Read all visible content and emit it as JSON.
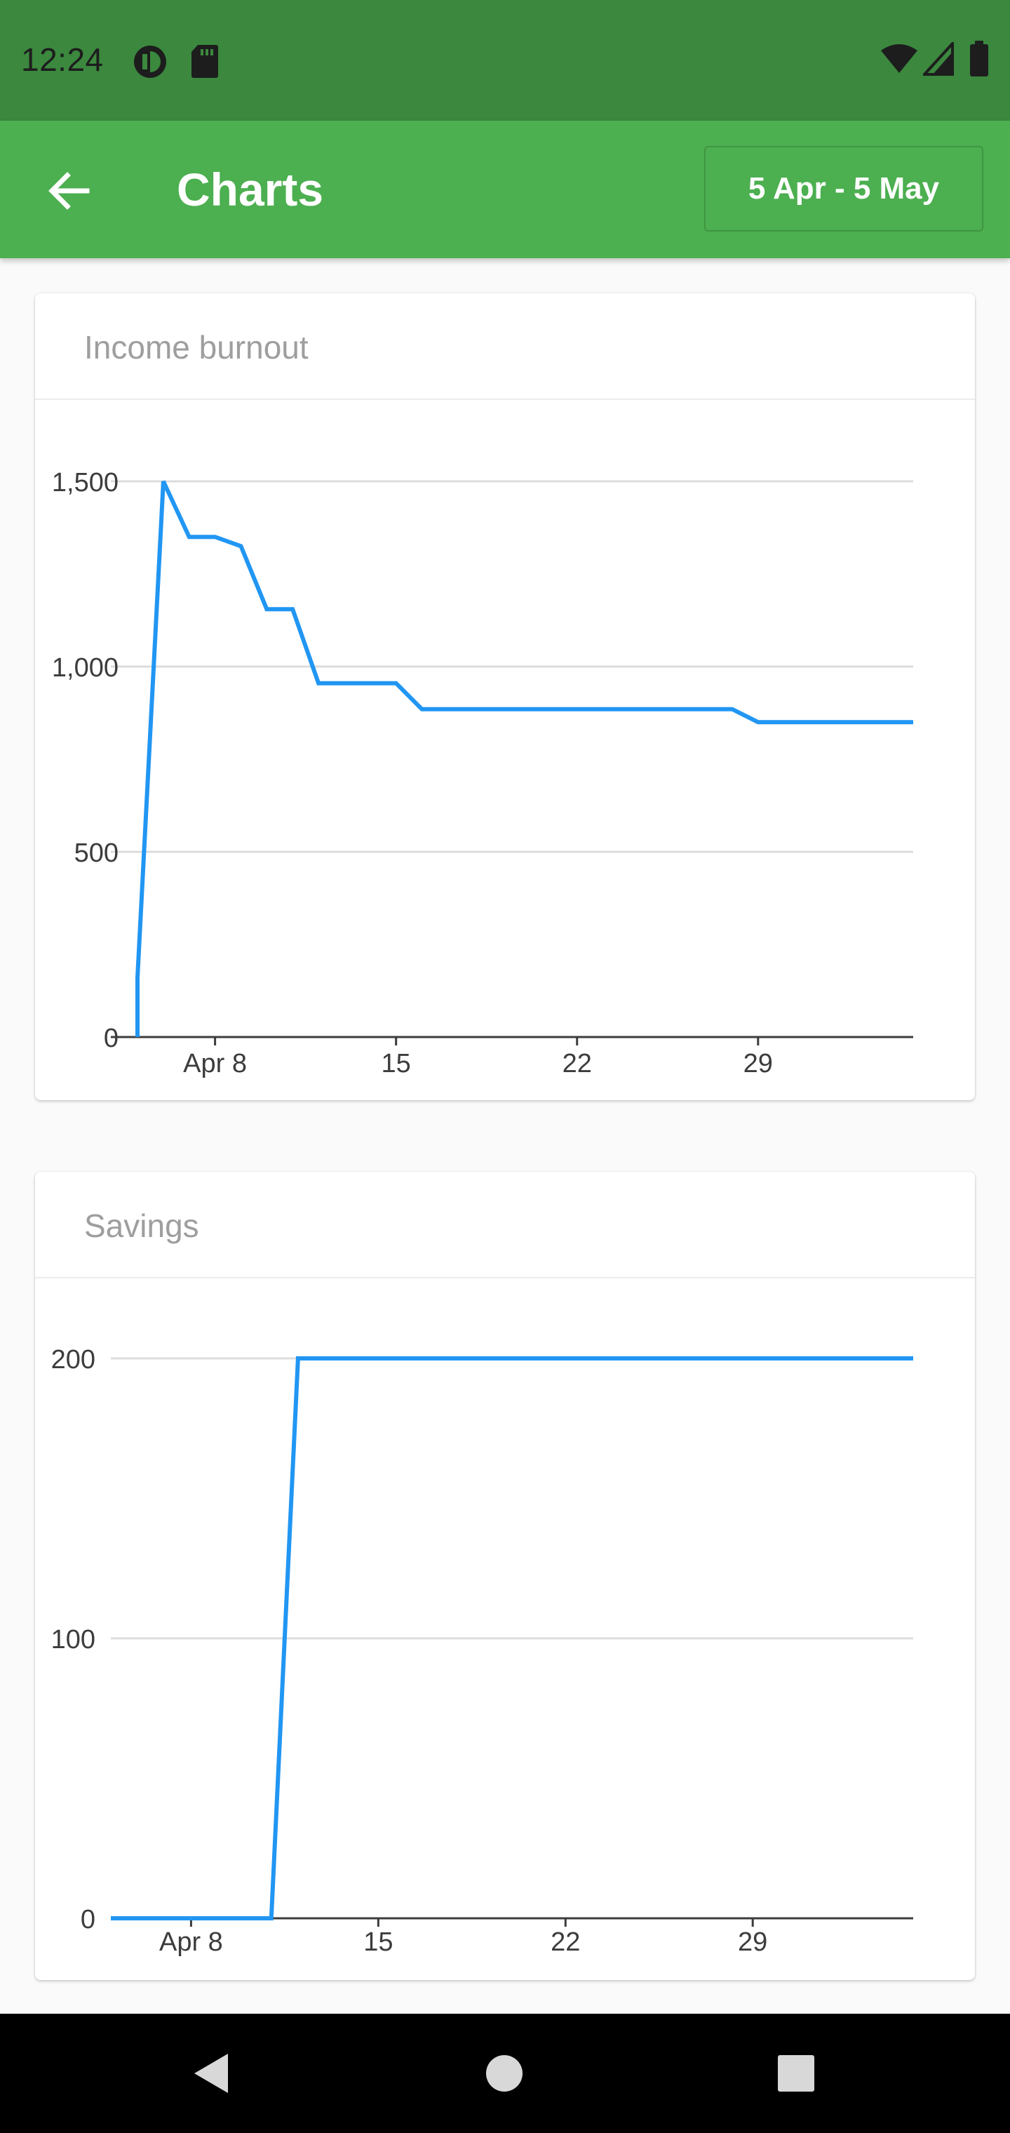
{
  "status_bar": {
    "time": "12:24",
    "left_icons": [
      "data-saver-icon",
      "sd-card-icon"
    ],
    "right_icons": [
      "wifi-icon",
      "cellular-signal-icon",
      "battery-icon"
    ]
  },
  "app_bar": {
    "back_icon": "arrow-back-icon",
    "title": "Charts",
    "date_range": "5 Apr - 5 May",
    "background": "#4caf50",
    "status_background": "#3b883e"
  },
  "chart_data": [
    {
      "type": "line",
      "title": "Income burnout",
      "xlabel": "",
      "ylabel": "",
      "color": "#2196f3",
      "ylim": [
        0,
        1500
      ],
      "yticks": [
        0,
        500,
        1000,
        1500
      ],
      "ytick_labels": [
        "0",
        "500",
        "1,000",
        "1,500"
      ],
      "xlim": [
        "2024-04-05",
        "2024-05-05"
      ],
      "xticks": [
        "2024-04-08",
        "2024-04-15",
        "2024-04-22",
        "2024-04-29"
      ],
      "xtick_labels": [
        "Apr 8",
        "15",
        "22",
        "29"
      ],
      "grid": true,
      "x": [
        "2024-04-05",
        "2024-04-05",
        "2024-04-06",
        "2024-04-07",
        "2024-04-08",
        "2024-04-09",
        "2024-04-10",
        "2024-04-11",
        "2024-04-12",
        "2024-04-13",
        "2024-04-14",
        "2024-04-15",
        "2024-04-16",
        "2024-04-28",
        "2024-04-29",
        "2024-05-05"
      ],
      "y": [
        0,
        160,
        1500,
        1350,
        1350,
        1325,
        1155,
        1155,
        955,
        955,
        955,
        955,
        885,
        885,
        850,
        850
      ]
    },
    {
      "type": "line",
      "title": "Savings",
      "xlabel": "",
      "ylabel": "",
      "color": "#2196f3",
      "ylim": [
        0,
        200
      ],
      "yticks": [
        0,
        100,
        200
      ],
      "ytick_labels": [
        "0",
        "100",
        "200"
      ],
      "xlim": [
        "2024-04-05",
        "2024-05-05"
      ],
      "xticks": [
        "2024-04-08",
        "2024-04-15",
        "2024-04-22",
        "2024-04-29"
      ],
      "xtick_labels": [
        "Apr 8",
        "15",
        "22",
        "29"
      ],
      "grid": true,
      "x": [
        "2024-04-05",
        "2024-04-11",
        "2024-04-12",
        "2024-05-05"
      ],
      "y": [
        0,
        0,
        200,
        200
      ]
    }
  ],
  "nav_bar": {
    "icons": [
      "back-triangle-icon",
      "home-circle-icon",
      "recents-square-icon"
    ]
  }
}
